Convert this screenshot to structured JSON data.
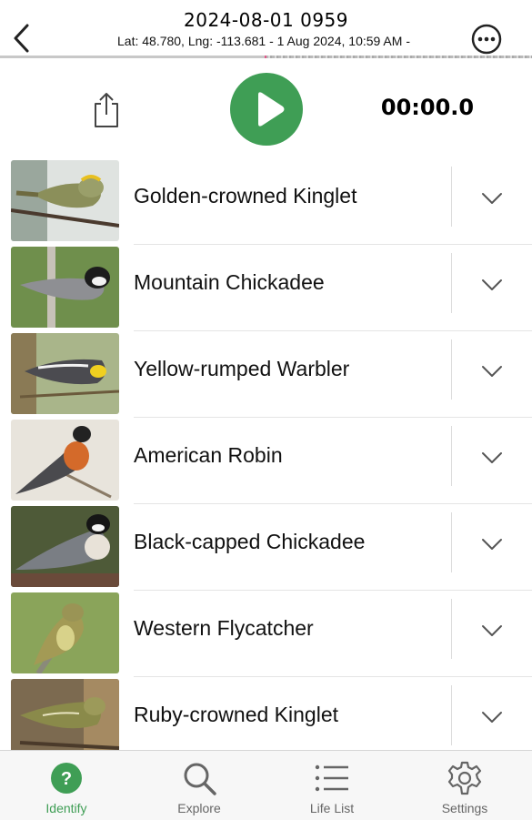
{
  "header": {
    "title": "2024-08-01 0959",
    "subtitle": "Lat: 48.780, Lng: -113.681 - 1 Aug 2024, 10:59 AM -"
  },
  "controls": {
    "timer": "00:00.0",
    "accent_color": "#3f9e55"
  },
  "birds": [
    {
      "name": "Golden-crowned Kinglet"
    },
    {
      "name": "Mountain Chickadee"
    },
    {
      "name": "Yellow-rumped Warbler"
    },
    {
      "name": "American Robin"
    },
    {
      "name": "Black-capped Chickadee"
    },
    {
      "name": "Western Flycatcher"
    },
    {
      "name": "Ruby-crowned Kinglet"
    }
  ],
  "tabs": [
    {
      "label": "Identify",
      "icon": "question-circle-icon",
      "active": true
    },
    {
      "label": "Explore",
      "icon": "search-icon",
      "active": false
    },
    {
      "label": "Life List",
      "icon": "list-icon",
      "active": false
    },
    {
      "label": "Settings",
      "icon": "gear-icon",
      "active": false
    }
  ]
}
